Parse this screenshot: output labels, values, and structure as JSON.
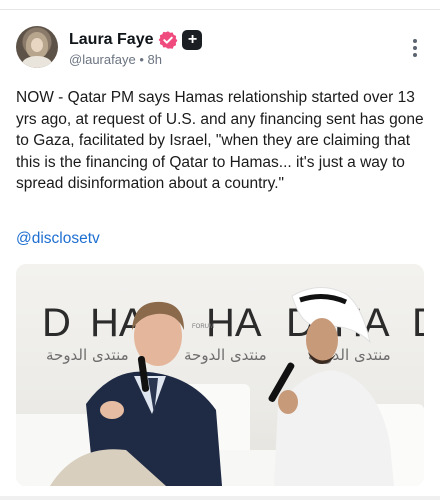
{
  "post": {
    "author_name": "Laura Faye",
    "handle": "@laurafaye",
    "separator": "•",
    "time": "8h",
    "text": "NOW - Qatar PM says Hamas relationship started over 13 yrs ago, at request of U.S. and any financing sent has gone to Gaza, facilitated by Israel, \"when they are claiming that this is the financing of Qatar to Hamas... it's just a way to spread disinformation about a country.\"",
    "mention": "@disclosetv",
    "plus_badge": "+"
  },
  "icons": {
    "verified": "verified-badge-icon",
    "more": "more-options-icon"
  },
  "colors": {
    "verified_badge": "#f04b7f",
    "link": "#1d6fd1",
    "backdrop_text": "#2b2b2b"
  },
  "media": {
    "backdrop_word": "HA",
    "backdrop_letter_d": "D",
    "backdrop_arabic": "منتدى الدوحة",
    "forum_label": "FORUM"
  }
}
